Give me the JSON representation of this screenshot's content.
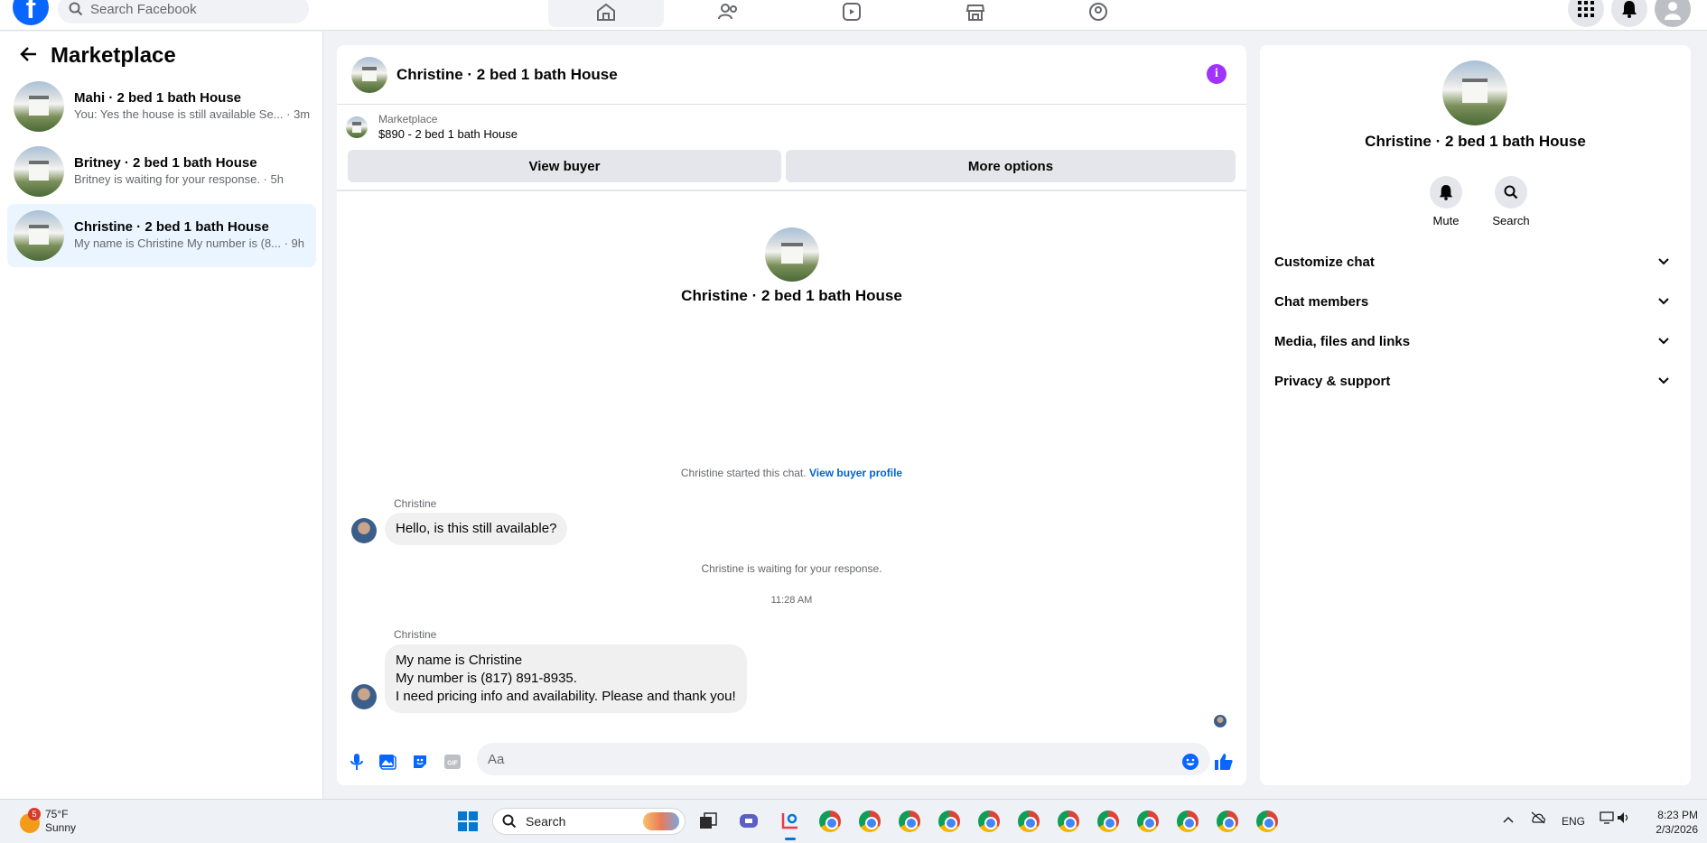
{
  "topbar": {
    "search_placeholder": "Search Facebook",
    "accent": "#0866ff"
  },
  "sidebar": {
    "title": "Marketplace",
    "conversations": [
      {
        "name": "Mahi · 2 bed 1 bath House",
        "preview": "You: Yes the house is still available Se... · 3m",
        "selected": false
      },
      {
        "name": "Britney · 2 bed 1 bath House",
        "preview": "Britney is waiting for your response. · 5h",
        "selected": false
      },
      {
        "name": "Christine · 2 bed 1 bath House",
        "preview": "My name is Christine My number is (8... · 9h",
        "selected": true
      }
    ]
  },
  "chat": {
    "title": "Christine · 2 bed 1 bath House",
    "marketplace_label": "Marketplace",
    "listing": "$890 - 2 bed 1 bath House",
    "view_buyer": "View buyer",
    "more_options": "More options",
    "center_title": "Christine · 2 bed 1 bath House",
    "started_text": "Christine started this chat.",
    "view_buyer_profile": "View buyer profile",
    "messages": [
      {
        "sender": "Christine",
        "lines": [
          "Hello, is this still available?"
        ]
      },
      {
        "sender": "Christine",
        "lines": [
          "My name is Christine",
          "My number is (817) 891-8935.",
          "I need pricing info and availability. Please and thank you!"
        ]
      }
    ],
    "waiting_text": "Christine is waiting for your response.",
    "timestamp": "11:28 AM",
    "input_placeholder": "Aa"
  },
  "info_panel": {
    "title": "Christine · 2 bed 1 bath House",
    "actions": [
      {
        "label": "Mute",
        "icon": "bell-icon"
      },
      {
        "label": "Search",
        "icon": "search-icon"
      }
    ],
    "sections": [
      "Customize chat",
      "Chat members",
      "Media, files and links",
      "Privacy & support"
    ],
    "info_color": "#a033ff"
  },
  "taskbar": {
    "weather_temp": "75°F",
    "weather_desc": "Sunny",
    "weather_badge": "5",
    "search_label": "Search",
    "language": "ENG",
    "time": "8:23 PM",
    "date": "2/3/2026"
  }
}
